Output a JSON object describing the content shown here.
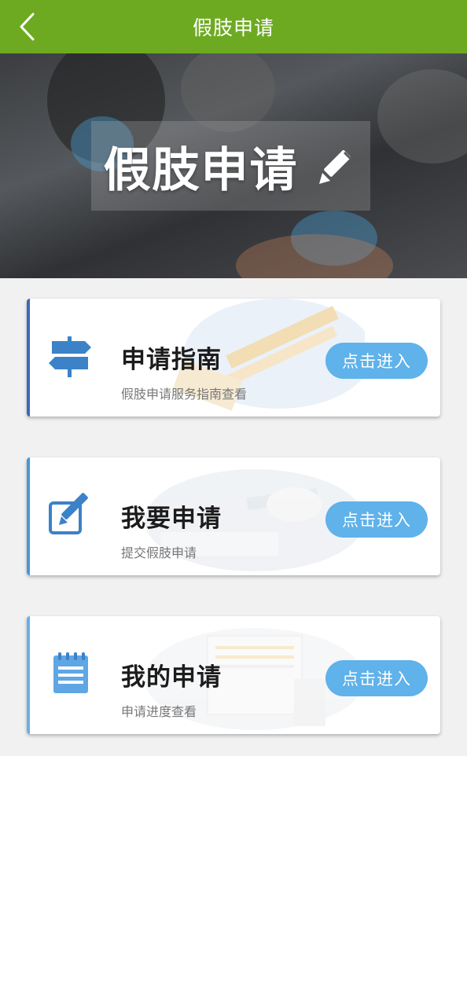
{
  "navbar": {
    "title": "假肢申请",
    "back_icon": "chevron-left-icon",
    "background": "#6daa22"
  },
  "banner": {
    "title": "假肢申请",
    "edit_icon": "pencil-icon"
  },
  "cards": [
    {
      "title": "申请指南",
      "subtitle": "假肢申请服务指南查看",
      "button": "点击进入",
      "icon": "signpost-icon",
      "accent": "#3f67b8"
    },
    {
      "title": "我要申请",
      "subtitle": "提交假肢申请",
      "button": "点击进入",
      "icon": "edit-form-icon",
      "accent": "#4a95d8"
    },
    {
      "title": "我的申请",
      "subtitle": "申请进度查看",
      "button": "点击进入",
      "icon": "notepad-icon",
      "accent": "#6aaee6"
    }
  ],
  "colors": {
    "button": "#5fb2ea",
    "icon_blue": "#3b82c8",
    "content_bg": "#f1f1f1"
  }
}
